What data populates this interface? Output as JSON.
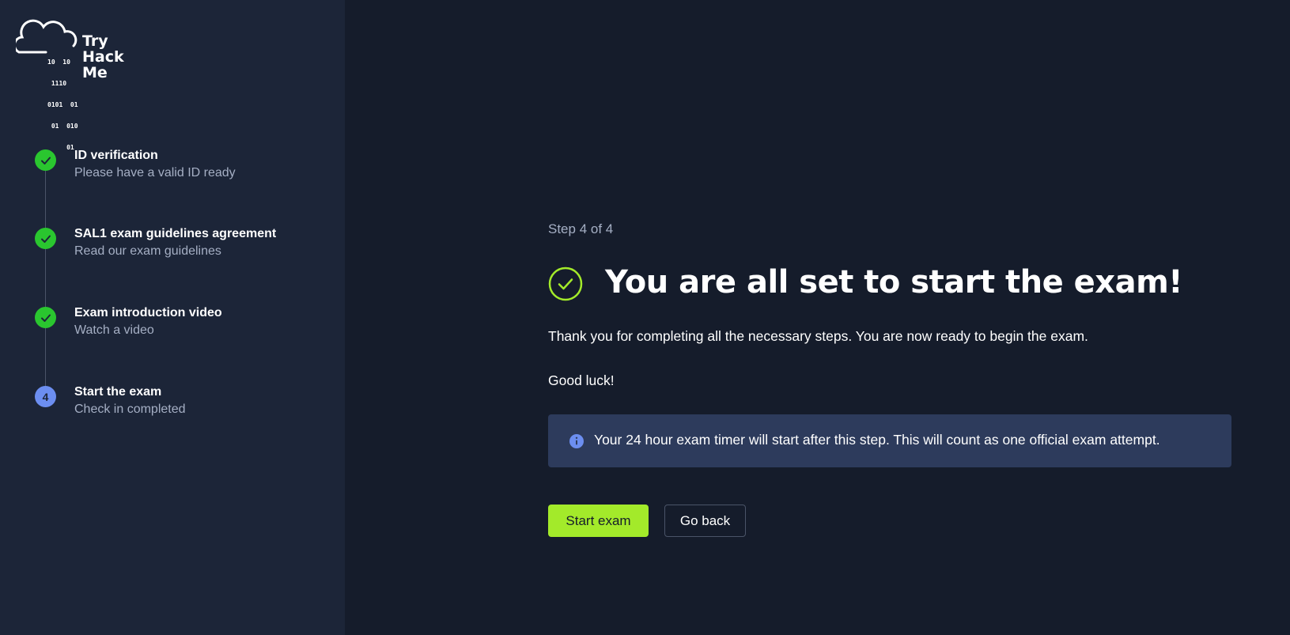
{
  "logo": {
    "bits": [
      "10  10",
      " 1110",
      "0101  01",
      " 01  010",
      "     01"
    ],
    "lines": [
      "Try",
      "Hack",
      "Me"
    ]
  },
  "steps": [
    {
      "title": "ID verification",
      "subtitle": "Please have a valid ID ready",
      "status": "done"
    },
    {
      "title": "SAL1 exam guidelines agreement",
      "subtitle": "Read our exam guidelines",
      "status": "done"
    },
    {
      "title": "Exam introduction video",
      "subtitle": "Watch a video",
      "status": "done"
    },
    {
      "title": "Start the exam",
      "subtitle": "Check in completed",
      "status": "current",
      "number": "4"
    }
  ],
  "main": {
    "step_counter": "Step 4 of 4",
    "heading": "You are all set to start the exam!",
    "description": "Thank you for completing all the necessary steps. You are now ready to begin the exam.",
    "good_luck": "Good luck!",
    "notice": "Your 24 hour exam timer will start after this step. This will count as one official exam attempt.",
    "start_button": "Start exam",
    "back_button": "Go back"
  },
  "colors": {
    "sidebar_bg": "#1c2538",
    "main_bg": "#151c2b",
    "step_done": "#2ac62f",
    "step_current": "#6c8ef0",
    "accent": "#a3ea2a",
    "notice_bg": "#2d3b5c",
    "muted_text": "#a5afc4"
  },
  "icons": {
    "step_done": "check-icon",
    "heading": "check-circle-icon",
    "notice": "info-icon"
  }
}
